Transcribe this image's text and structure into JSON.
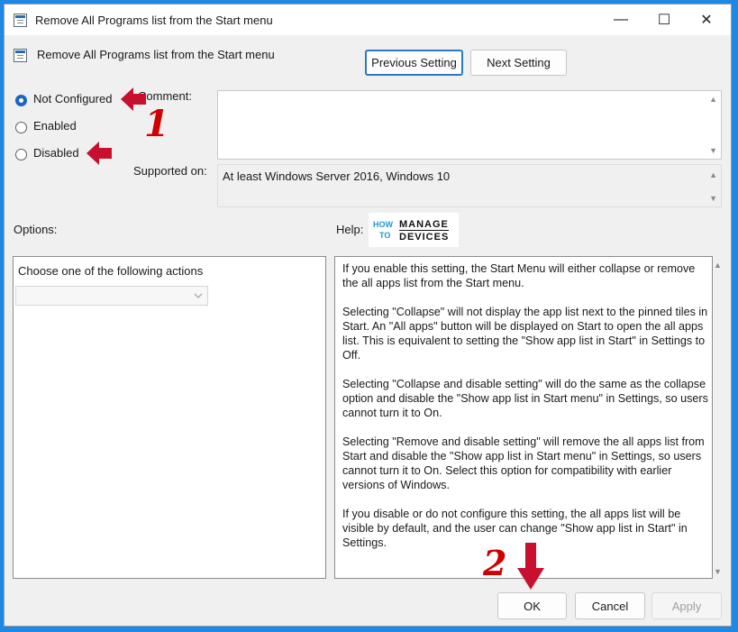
{
  "window": {
    "title": "Remove All Programs list from the Start menu",
    "controls": {
      "minimize": "—",
      "maximize": "☐",
      "close": "✕"
    }
  },
  "header": {
    "setting_name": "Remove All Programs list from the Start menu",
    "previous_label": "Previous Setting",
    "next_label": "Next Setting"
  },
  "state": {
    "options": [
      {
        "label": "Not Configured",
        "checked": true
      },
      {
        "label": "Enabled",
        "checked": false
      },
      {
        "label": "Disabled",
        "checked": false
      }
    ]
  },
  "comment": {
    "label": "Comment:",
    "value": ""
  },
  "supported": {
    "label": "Supported on:",
    "value": "At least Windows Server 2016, Windows 10"
  },
  "options_section": {
    "label": "Options:",
    "prompt": "Choose one of the following actions",
    "dropdown_value": ""
  },
  "help_section": {
    "label": "Help:",
    "logo": {
      "top": "HOW",
      "bottom": "TO",
      "right_top": "MANAGE",
      "right_bottom": "DEVICES"
    },
    "paragraphs": [
      "If you enable this setting, the Start Menu will either collapse or remove the all apps list from the Start menu.",
      "Selecting \"Collapse\" will not display the app list next to the pinned tiles in Start. An \"All apps\" button will be displayed on Start to open the all apps list. This is equivalent to setting the \"Show app list in Start\" in Settings to Off.",
      "Selecting \"Collapse and disable setting\" will do the same as the collapse option and disable the \"Show app list in Start menu\" in Settings, so users cannot turn it to On.",
      "Selecting \"Remove and disable setting\" will remove the all apps list from Start and disable the \"Show app list in Start menu\" in Settings, so users cannot turn it to On. Select this option for compatibility with earlier versions of Windows.",
      "If you disable or do not configure this setting, the all apps list will be visible by default, and the user can change \"Show app list in Start\" in Settings."
    ]
  },
  "footer": {
    "ok_label": "OK",
    "cancel_label": "Cancel",
    "apply_label": "Apply"
  },
  "annotations": {
    "marker1": "1",
    "marker2": "2",
    "color": "#c8102e"
  },
  "colors": {
    "background": "#1e88e5",
    "radio_selected": "#1a66c2",
    "focus_border": "#2b79c2"
  }
}
